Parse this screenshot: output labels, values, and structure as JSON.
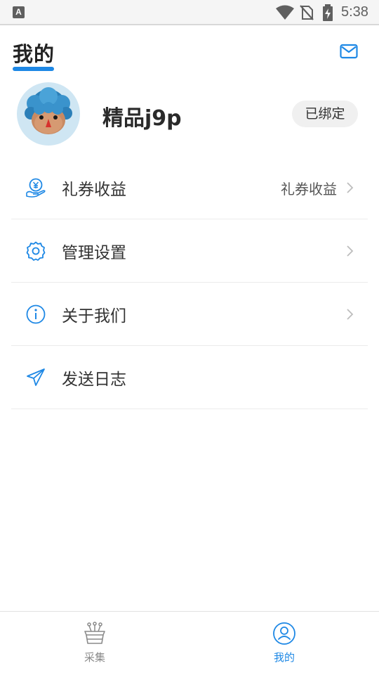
{
  "status_bar": {
    "time": "5:38",
    "left_icon": "A",
    "icons": [
      "wifi-icon",
      "no-sim-icon",
      "battery-charging-icon"
    ]
  },
  "header": {
    "title": "我的",
    "mail_icon": "mail-icon",
    "accent_color": "#1e88e5"
  },
  "profile": {
    "username": "精品j9p",
    "badge": "已绑定",
    "avatar_icon": "avatar-cartoon-icon"
  },
  "menu": {
    "items": [
      {
        "icon": "coupon-income-icon",
        "label": "礼券收益",
        "value": "礼券收益",
        "chevron": true
      },
      {
        "icon": "settings-gear-icon",
        "label": "管理设置",
        "value": "",
        "chevron": true
      },
      {
        "icon": "info-icon",
        "label": "关于我们",
        "value": "",
        "chevron": true
      },
      {
        "icon": "send-paper-plane-icon",
        "label": "发送日志",
        "value": "",
        "chevron": false
      }
    ]
  },
  "bottom_nav": {
    "items": [
      {
        "label": "采集",
        "icon": "collect-basket-icon",
        "active": false
      },
      {
        "label": "我的",
        "icon": "user-profile-icon",
        "active": true
      }
    ]
  }
}
